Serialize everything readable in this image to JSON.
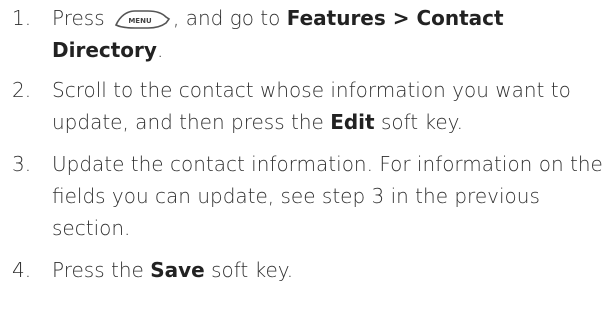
{
  "steps": [
    {
      "number": "1.",
      "parts": {
        "pre": "Press",
        "key_label": "MENU",
        "mid": ", and go to",
        "bold1": "Features > Contact",
        "bold2": "Directory",
        "post": "."
      }
    },
    {
      "number": "2.",
      "parts": {
        "pre": "Scroll to the contact whose information you want to update, and then press the",
        "bold": "Edit",
        "post": "soft key."
      }
    },
    {
      "number": "3.",
      "text": "Update the contact information. For information on the fields you can update, see step 3 in the previous section."
    },
    {
      "number": "4.",
      "parts": {
        "pre": "Press the",
        "bold": "Save",
        "post": "soft key."
      }
    }
  ],
  "icons": {
    "menu_key": "menu-key-icon"
  }
}
